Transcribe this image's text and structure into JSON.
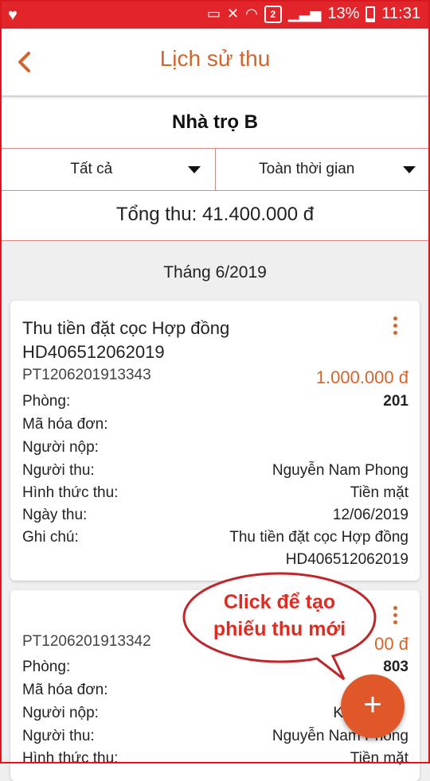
{
  "status_bar": {
    "battery": "13%",
    "time": "11:31",
    "sim_badge": "2",
    "icons": [
      "heart-icon",
      "cast-icon",
      "mute-icon",
      "wifi-icon",
      "signal-icon",
      "battery-icon"
    ]
  },
  "header": {
    "title": "Lịch sử thu",
    "back_icon": "chevron-left-icon"
  },
  "property": {
    "name": "Nhà trọ B"
  },
  "filters": {
    "type": "Tất cả",
    "period": "Toàn thời gian"
  },
  "summary": {
    "total": "Tổng thu: 41.400.000 đ"
  },
  "group": {
    "month": "Tháng 6/2019"
  },
  "receipts": [
    {
      "title": "Thu tiền đặt cọc Hợp đồng HD406512062019",
      "code": "PT1206201913343",
      "amount": "1.000.000 đ",
      "fields": [
        {
          "label": "Phòng:",
          "value": "201"
        },
        {
          "label": "Mã hóa đơn:",
          "value": ""
        },
        {
          "label": "Người nộp:",
          "value": ""
        },
        {
          "label": "Người thu:",
          "value": "Nguyễn Nam Phong"
        },
        {
          "label": "Hình thức thu:",
          "value": "Tiền mặt"
        },
        {
          "label": "Ngày thu:",
          "value": "12/06/2019"
        },
        {
          "label": "Ghi chú:",
          "value": "Thu tiền đặt cọc Hợp đồng",
          "value2": "HD406512062019"
        }
      ]
    },
    {
      "code": "PT1206201913342",
      "amount_visible": "00 đ",
      "fields": [
        {
          "label": "Phòng:",
          "value": "803"
        },
        {
          "label": "Mã hóa đơn:",
          "value": ""
        },
        {
          "label": "Người nộp:",
          "value": "K"
        },
        {
          "label": "Người thu:",
          "value": "Nguyễn Nam Phong"
        },
        {
          "label": "Hình thức thu:",
          "value": "Tiền mặt"
        }
      ]
    }
  ],
  "callout": {
    "line1": "Click để tạo",
    "line2": "phiếu thu mới"
  },
  "fab": {
    "label": "+",
    "icon": "plus-icon"
  },
  "colors": {
    "status_bar": "#e2252b",
    "accent": "#d6632a",
    "fab": "#e0582a",
    "callout_text": "#e12b20"
  }
}
